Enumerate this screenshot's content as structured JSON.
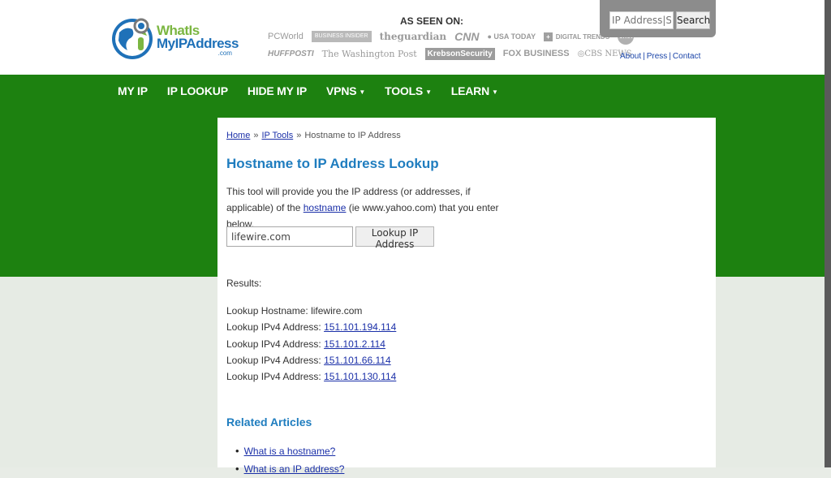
{
  "logo": {
    "line1": "WhatIs",
    "line2": "MyIPAddress",
    "line3": ".com"
  },
  "as_seen_on": {
    "heading": "AS SEEN ON:",
    "row1": [
      "PCWorld",
      "BUSINESS INSIDER",
      "theguardian",
      "CNN",
      "USA TODAY",
      "DIGITAL TRENDS",
      "cnet"
    ],
    "row2": [
      "HUFFPOSTI",
      "The Washington Post",
      "KrebsonSecurity",
      "FOX BUSINESS",
      "CBS NEWS"
    ]
  },
  "top_search": {
    "placeholder": "IP Address|Sea",
    "button": "Search"
  },
  "top_links": {
    "about": "About",
    "press": "Press",
    "contact": "Contact",
    "sep": "|"
  },
  "nav": [
    {
      "label": "MY IP",
      "dropdown": false
    },
    {
      "label": "IP LOOKUP",
      "dropdown": false
    },
    {
      "label": "HIDE MY IP",
      "dropdown": false
    },
    {
      "label": "VPNS",
      "dropdown": true
    },
    {
      "label": "TOOLS",
      "dropdown": true
    },
    {
      "label": "LEARN",
      "dropdown": true
    }
  ],
  "breadcrumb": {
    "home": "Home",
    "tools": "IP Tools",
    "current": "Hostname to IP Address",
    "sep": "»"
  },
  "page_title": "Hostname to IP Address Lookup",
  "description": {
    "before": "This tool will provide you the IP address (or addresses, if applicable) of the ",
    "link": "hostname",
    "after": " (ie www.yahoo.com) that you enter below."
  },
  "lookup": {
    "value": "lifewire.com",
    "button": "Lookup IP Address"
  },
  "results": {
    "label": "Results:",
    "hostname_label": "Lookup Hostname:",
    "hostname": "lifewire.com",
    "ipv4_label": "Lookup IPv4 Address:",
    "addresses": [
      "151.101.194.114",
      "151.101.2.114",
      "151.101.66.114",
      "151.101.130.114"
    ]
  },
  "related": {
    "title": "Related Articles",
    "items": [
      "What is a hostname?",
      "What is an IP address?"
    ]
  }
}
